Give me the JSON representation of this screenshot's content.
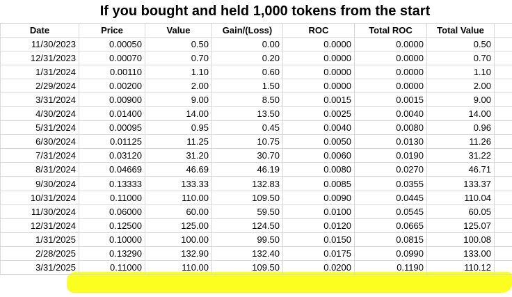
{
  "title": "If you bought and held 1,000 tokens from the start",
  "colors": {
    "highlight": "#fbff14",
    "grid": "#d9d9d9"
  },
  "headers": [
    "Date",
    "Price",
    "Value",
    "Gain/(Loss)",
    "ROC",
    "Total ROC",
    "Total Value"
  ],
  "rows": [
    [
      "11/30/2023",
      "0.00050",
      "0.50",
      "0.00",
      "0.0000",
      "0.0000",
      "0.50"
    ],
    [
      "12/31/2023",
      "0.00070",
      "0.70",
      "0.20",
      "0.0000",
      "0.0000",
      "0.70"
    ],
    [
      "1/31/2024",
      "0.00110",
      "1.10",
      "0.60",
      "0.0000",
      "0.0000",
      "1.10"
    ],
    [
      "2/29/2024",
      "0.00200",
      "2.00",
      "1.50",
      "0.0000",
      "0.0000",
      "2.00"
    ],
    [
      "3/31/2024",
      "0.00900",
      "9.00",
      "8.50",
      "0.0015",
      "0.0015",
      "9.00"
    ],
    [
      "4/30/2024",
      "0.01400",
      "14.00",
      "13.50",
      "0.0025",
      "0.0040",
      "14.00"
    ],
    [
      "5/31/2024",
      "0.00095",
      "0.95",
      "0.45",
      "0.0040",
      "0.0080",
      "0.96"
    ],
    [
      "6/30/2024",
      "0.01125",
      "11.25",
      "10.75",
      "0.0050",
      "0.0130",
      "11.26"
    ],
    [
      "7/31/2024",
      "0.03120",
      "31.20",
      "30.70",
      "0.0060",
      "0.0190",
      "31.22"
    ],
    [
      "8/31/2024",
      "0.04669",
      "46.69",
      "46.19",
      "0.0080",
      "0.0270",
      "46.71"
    ],
    [
      "9/30/2024",
      "0.13333",
      "133.33",
      "132.83",
      "0.0085",
      "0.0355",
      "133.37"
    ],
    [
      "10/31/2024",
      "0.11000",
      "110.00",
      "109.50",
      "0.0090",
      "0.0445",
      "110.04"
    ],
    [
      "11/30/2024",
      "0.06000",
      "60.00",
      "59.50",
      "0.0100",
      "0.0545",
      "60.05"
    ],
    [
      "12/31/2024",
      "0.12500",
      "125.00",
      "124.50",
      "0.0120",
      "0.0665",
      "125.07"
    ],
    [
      "1/31/2025",
      "0.10000",
      "100.00",
      "99.50",
      "0.0150",
      "0.0815",
      "100.08"
    ],
    [
      "2/28/2025",
      "0.13290",
      "132.90",
      "132.40",
      "0.0175",
      "0.0990",
      "133.00"
    ],
    [
      "3/31/2025",
      "0.11000",
      "110.00",
      "109.50",
      "0.0200",
      "0.1190",
      "110.12"
    ]
  ]
}
